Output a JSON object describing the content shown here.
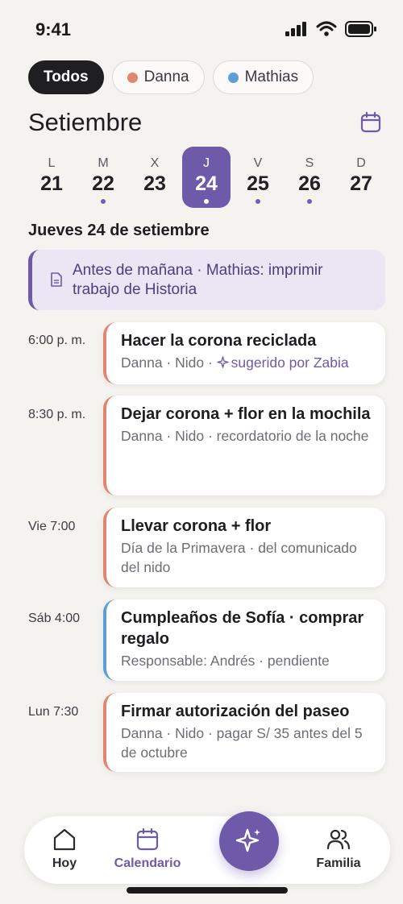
{
  "status": {
    "time": "9:41"
  },
  "filters": [
    {
      "label": "Todos",
      "active": true
    },
    {
      "label": "Danna",
      "dot_color": "#e2856f"
    },
    {
      "label": "Mathias",
      "dot_color": "#5a9fd6"
    }
  ],
  "month": "Setiembre",
  "week": [
    {
      "letter": "L",
      "num": "21",
      "dot": false
    },
    {
      "letter": "M",
      "num": "22",
      "dot": true
    },
    {
      "letter": "X",
      "num": "23",
      "dot": false
    },
    {
      "letter": "J",
      "num": "24",
      "dot": true,
      "selected": true
    },
    {
      "letter": "V",
      "num": "25",
      "dot": true
    },
    {
      "letter": "S",
      "num": "26",
      "dot": true
    },
    {
      "letter": "D",
      "num": "27",
      "dot": false
    }
  ],
  "date_heading": "Jueves 24 de setiembre",
  "note": {
    "text": "Antes de mañana · Mathias: imprimir trabajo de Historia",
    "icon": "document-icon"
  },
  "events": [
    {
      "time": "6:00 p. m.",
      "title": "Hacer la corona reciclada",
      "sub": "Danna · Nido · ",
      "suggestion": "sugerido por Zabia",
      "color": "#e2856f"
    },
    {
      "time": "8:30 p. m.",
      "title": "Dejar corona + flor en la mochila",
      "sub": "Danna · Nido · recordatorio de la noche",
      "color": "#e2856f"
    },
    {
      "time": "Vie 7:00",
      "title": "Llevar corona + flor",
      "sub": "Día de la Primavera · del comunicado del nido",
      "color": "#e2856f"
    },
    {
      "time": "Sáb 4:00",
      "title": "Cumpleaños de Sofía · comprar regalo",
      "sub": "Responsable: Andrés · pendiente",
      "color": "#5a9fd6"
    },
    {
      "time": "Lun 7:30",
      "title": "Firmar autorización del paseo",
      "sub": "Danna · Nido · pagar S/ 35 antes del 5 de octubre",
      "color": "#e2856f"
    }
  ],
  "tabs": [
    {
      "label": "Hoy",
      "icon": "home-icon"
    },
    {
      "label": "Calendario",
      "icon": "calendar-icon",
      "active": true
    },
    {
      "label": "Familia",
      "icon": "people-icon"
    }
  ],
  "fab_icon": "sparkle-icon",
  "colors": {
    "accent": "#6e5aa8",
    "danna": "#e2856f",
    "mathias": "#5a9fd6"
  }
}
